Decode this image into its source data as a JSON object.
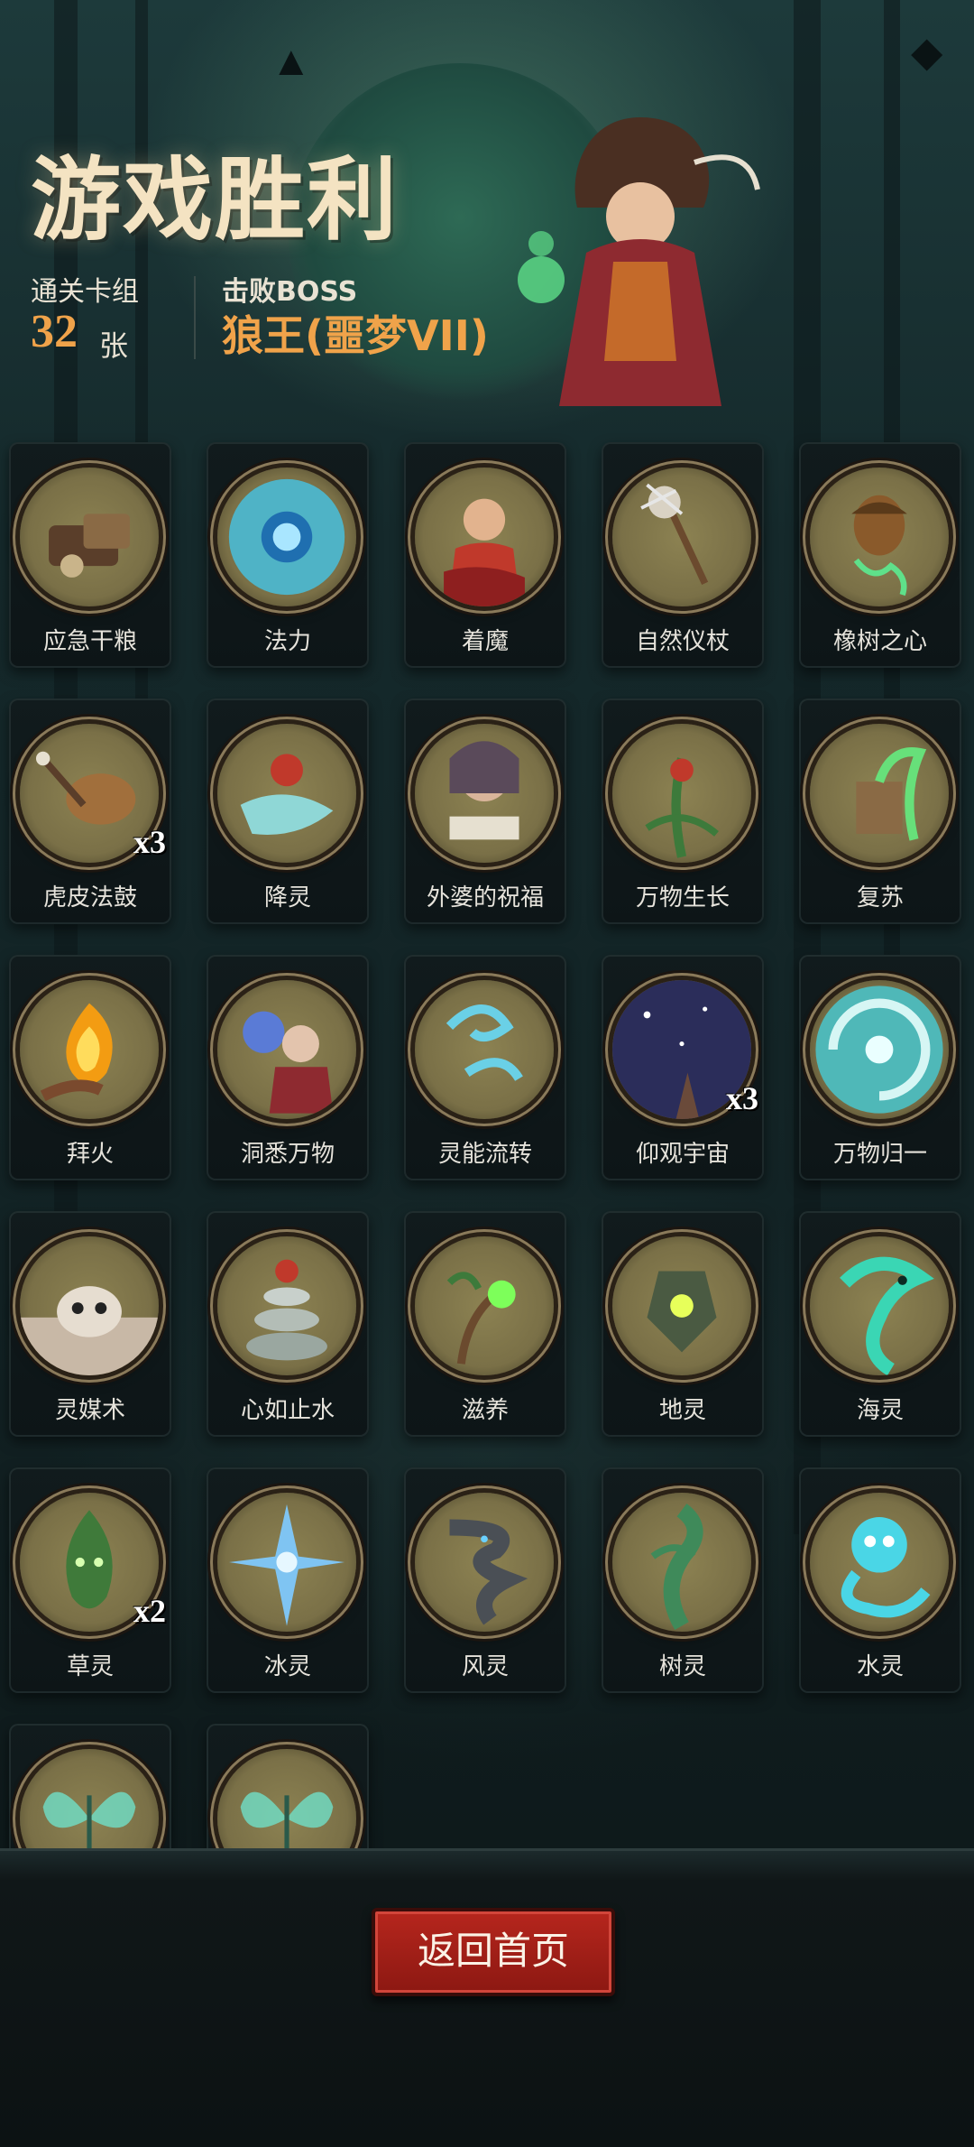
{
  "header": {
    "title": "游戏胜利",
    "deck_label": "通关卡组",
    "deck_count": "32",
    "deck_unit": "张",
    "boss_label": "击败BOSS",
    "boss_name": "狼王(噩梦VII)"
  },
  "cards": [
    {
      "name": "应急干粮",
      "count": "",
      "icon": "ration-bag-icon"
    },
    {
      "name": "法力",
      "count": "",
      "icon": "mana-orb-icon"
    },
    {
      "name": "着魔",
      "count": "",
      "icon": "possessed-boy-icon"
    },
    {
      "name": "自然仪杖",
      "count": "",
      "icon": "nature-staff-icon"
    },
    {
      "name": "橡树之心",
      "count": "",
      "icon": "acorn-icon"
    },
    {
      "name": "虎皮法鼓",
      "count": "x3",
      "icon": "drum-icon"
    },
    {
      "name": "降灵",
      "count": "",
      "icon": "summon-spirit-icon"
    },
    {
      "name": "外婆的祝福",
      "count": "",
      "icon": "grandma-icon"
    },
    {
      "name": "万物生长",
      "count": "",
      "icon": "growth-icon"
    },
    {
      "name": "复苏",
      "count": "",
      "icon": "revive-stump-icon"
    },
    {
      "name": "拜火",
      "count": "",
      "icon": "fire-hand-icon"
    },
    {
      "name": "洞悉万物",
      "count": "",
      "icon": "insight-witch-icon"
    },
    {
      "name": "灵能流转",
      "count": "",
      "icon": "energy-flow-icon"
    },
    {
      "name": "仰观宇宙",
      "count": "x3",
      "icon": "starry-sky-icon"
    },
    {
      "name": "万物归一",
      "count": "",
      "icon": "vortex-icon"
    },
    {
      "name": "灵媒术",
      "count": "",
      "icon": "skull-ritual-icon"
    },
    {
      "name": "心如止水",
      "count": "",
      "icon": "stone-stack-icon"
    },
    {
      "name": "滋养",
      "count": "",
      "icon": "nourish-sprout-icon"
    },
    {
      "name": "地灵",
      "count": "",
      "icon": "earth-spirit-icon"
    },
    {
      "name": "海灵",
      "count": "",
      "icon": "sea-spirit-icon"
    },
    {
      "name": "草灵",
      "count": "x2",
      "icon": "grass-spirit-icon"
    },
    {
      "name": "冰灵",
      "count": "",
      "icon": "ice-spirit-icon"
    },
    {
      "name": "风灵",
      "count": "",
      "icon": "wind-spirit-icon"
    },
    {
      "name": "树灵",
      "count": "",
      "icon": "tree-spirit-icon"
    },
    {
      "name": "水灵",
      "count": "",
      "icon": "water-spirit-icon"
    },
    {
      "name": "",
      "count": "",
      "icon": "butterfly-icon"
    },
    {
      "name": "",
      "count": "",
      "icon": "butterfly-icon"
    }
  ],
  "footer": {
    "home_label": "返回首页"
  },
  "colors": {
    "accent_orange": "#f0a34a",
    "button_red": "#b6261d",
    "medal_gold": "#8c8252"
  }
}
